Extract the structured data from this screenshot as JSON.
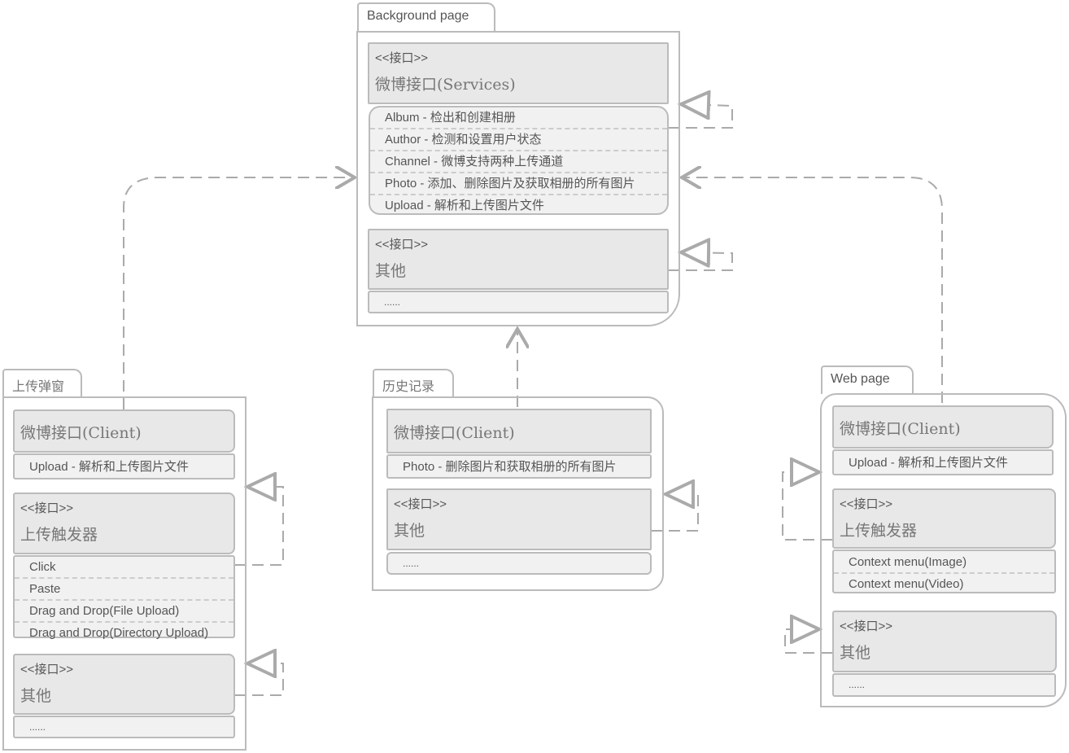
{
  "background": {
    "tab": "Background page",
    "services": {
      "stereotype": "<<接口>>",
      "name": "微博接口(Services)",
      "items": [
        "Album - 检出和创建相册",
        "Author - 检测和设置用户状态",
        "Channel - 微博支持两种上传通道",
        "Photo - 添加、删除图片及获取相册的所有图片",
        "Upload - 解析和上传图片文件"
      ]
    },
    "other": {
      "stereotype": "<<接口>>",
      "name": "其他",
      "items": [
        "......"
      ]
    }
  },
  "upload_popup": {
    "tab": "上传弹窗",
    "client": {
      "name": "微博接口(Client)",
      "items": [
        "Upload - 解析和上传图片文件"
      ]
    },
    "trigger": {
      "stereotype": "<<接口>>",
      "name": "上传触发器",
      "items": [
        "Click",
        "Paste",
        "Drag and Drop(File Upload)",
        "Drag and Drop(Directory Upload)"
      ]
    },
    "other": {
      "stereotype": "<<接口>>",
      "name": "其他",
      "items": [
        "......"
      ]
    }
  },
  "history": {
    "tab": "历史记录",
    "client": {
      "name": "微博接口(Client)",
      "items": [
        "Photo -  删除图片和获取相册的所有图片"
      ]
    },
    "other": {
      "stereotype": "<<接口>>",
      "name": "其他",
      "items": [
        "......"
      ]
    }
  },
  "web_page": {
    "tab": "Web page",
    "client": {
      "name": "微博接口(Client)",
      "items": [
        "Upload - 解析和上传图片文件"
      ]
    },
    "trigger": {
      "stereotype": "<<接口>>",
      "name": "上传触发器",
      "items": [
        "Context menu(Image)",
        "Context menu(Video)"
      ]
    },
    "other": {
      "stereotype": "<<接口>>",
      "name": "其他",
      "items": [
        "......"
      ]
    }
  },
  "colors": {
    "line": "#aaaaaa",
    "header_fill": "#e8e8e8",
    "list_fill": "#f1f1f1"
  }
}
